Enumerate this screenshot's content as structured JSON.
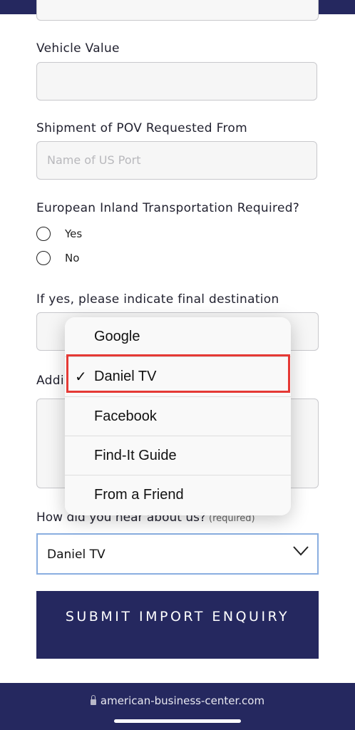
{
  "form": {
    "vehicle_value_label": "Vehicle Value",
    "vehicle_value": "",
    "shipment_label": "Shipment of POV Requested From",
    "shipment_placeholder": "Name of US Port",
    "inland_label": "European Inland Transportation Required?",
    "inland_options": [
      {
        "label": "Yes",
        "selected": false
      },
      {
        "label": "No",
        "selected": false
      }
    ],
    "destination_label": "If yes, please indicate final destination",
    "additional_label_partial": "Addi",
    "hear_label": "How did you hear about us?",
    "hear_required": "(required)",
    "hear_value": "Daniel TV",
    "submit_label": "SUBMIT IMPORT ENQUIRY"
  },
  "dropdown": {
    "options": [
      {
        "label": "Google",
        "selected": false
      },
      {
        "label": "Daniel TV",
        "selected": true
      },
      {
        "label": "Facebook",
        "selected": false
      },
      {
        "label": "Find-It Guide",
        "selected": false
      },
      {
        "label": "From a Friend",
        "selected": false
      }
    ],
    "check_glyph": "✓"
  },
  "browser": {
    "url": "american-business-center.com"
  },
  "colors": {
    "brand_navy": "#25285f",
    "highlight_red": "#e53935",
    "select_focus": "#8aaee0"
  }
}
